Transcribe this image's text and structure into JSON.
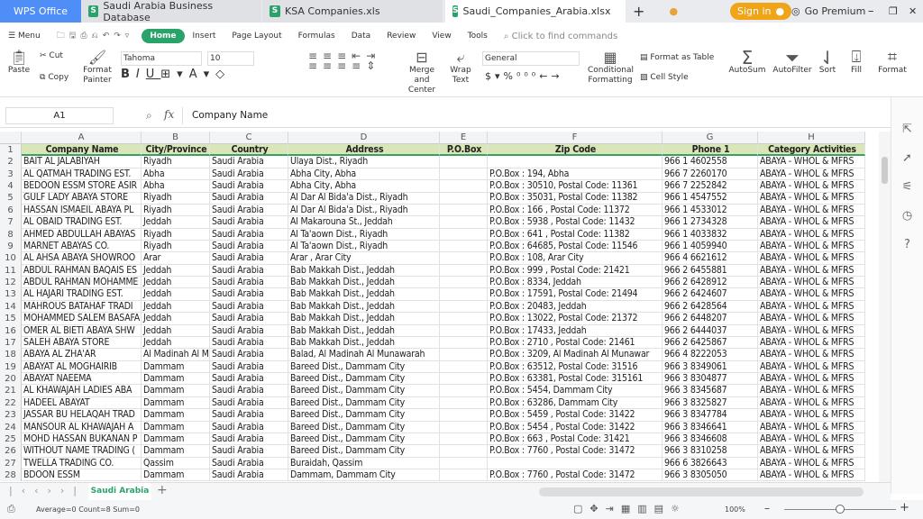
{
  "window": {
    "app_tab": "WPS Office",
    "tabs": [
      "Saudi Arabia Business Database",
      "KSA Companies.xls",
      "Saudi_Companies_Arabia.xlsx"
    ],
    "sign_in": "Sign in",
    "go_premium": "Go Premium"
  },
  "menu": {
    "menu_label": "Menu",
    "tabs": [
      "Home",
      "Insert",
      "Page Layout",
      "Formulas",
      "Data",
      "Review",
      "View",
      "Tools"
    ],
    "search_placeholder": "Click to find commands"
  },
  "ribbon": {
    "paste": "Paste",
    "cut": "Cut",
    "copy": "Copy",
    "format_painter": [
      "Format",
      "Painter"
    ],
    "font": "Tahoma",
    "size": "10",
    "merge": [
      "Merge and",
      "Center"
    ],
    "wrap": [
      "Wrap",
      "Text"
    ],
    "number_format": "General",
    "conditional": [
      "Conditional",
      "Formatting"
    ],
    "format_table": "Format as Table",
    "cell_style": "Cell Style",
    "autosum": "AutoSum",
    "autofilter": "AutoFilter",
    "sort": "Sort",
    "fill": "Fill",
    "format": "Format"
  },
  "formula_bar": {
    "cell_ref": "A1",
    "fx": "fx",
    "value": "Company Name"
  },
  "columns": [
    "A",
    "B",
    "C",
    "D",
    "E",
    "F",
    "G",
    "H"
  ],
  "headers": [
    "Company Name",
    "City/Province",
    "Country",
    "Address",
    "P.O.Box",
    "Zip Code",
    "Phone 1",
    "Category Activities"
  ],
  "rows": [
    [
      "BAIT AL JALABIYAH",
      "Riyadh",
      "Saudi Arabia",
      "Ulaya Dist., Riyadh",
      "",
      "",
      "966 1 4602558",
      "ABAYA - WHOL & MFRS"
    ],
    [
      "AL QATMAH TRADING EST.",
      "Abha",
      "Saudi Arabia",
      "Abha City, Abha",
      "",
      "P.O.Box : 194, Abha",
      "966 7 2260170",
      "ABAYA - WHOL & MFRS"
    ],
    [
      "BEDOON ESSM STORE ASIR",
      "Abha",
      "Saudi Arabia",
      "Abha City, Abha",
      "",
      "P.O.Box : 30510, Postal Code: 11361",
      "966 7 2252842",
      "ABAYA - WHOL & MFRS"
    ],
    [
      "GULF LADY ABAYA STORE",
      "Riyadh",
      "Saudi Arabia",
      "Al Dar Al Bida'a Dist., Riyadh",
      "",
      "P.O.Box : 35031, Postal Code: 11382",
      "966 1 4547552",
      "ABAYA - WHOL & MFRS"
    ],
    [
      "HASSAN ISMAEIL ABAYA PL",
      "Riyadh",
      "Saudi Arabia",
      "Al Dar Al Bida'a Dist., Riyadh",
      "",
      "P.O.Box : 166 , Postal Code: 11372",
      "966 1 4533012",
      "ABAYA - WHOL & MFRS"
    ],
    [
      "AL OBAID TRADING EST.",
      "Jeddah",
      "Saudi Arabia",
      "Al Makarouna St., Jeddah",
      "",
      "P.O.Box : 5938 , Postal Code: 11432",
      "966 1 2734328",
      "ABAYA - WHOL & MFRS"
    ],
    [
      "AHMED ABDULLAH ABAYAS",
      "Riyadh",
      "Saudi Arabia",
      "Al Ta'aown Dist., Riyadh",
      "",
      "P.O.Box : 641 , Postal Code: 11382",
      "966 1 4033832",
      "ABAYA - WHOL & MFRS"
    ],
    [
      "MARNET ABAYAS CO.",
      "Riyadh",
      "Saudi Arabia",
      "Al Ta'aown Dist., Riyadh",
      "",
      "P.O.Box : 64685, Postal Code: 11546",
      "966 1 4059940",
      "ABAYA - WHOL & MFRS"
    ],
    [
      "AL AHSA ABAYA SHOWROO",
      "Arar",
      "Saudi Arabia",
      "Arar , Arar City",
      "",
      "P.O.Box : 108, Arar City",
      "966 4 6621612",
      "ABAYA - WHOL & MFRS"
    ],
    [
      "ABDUL RAHMAN BAQAIS ES",
      "Jeddah",
      "Saudi Arabia",
      "Bab Makkah Dist., Jeddah",
      "",
      "P.O.Box : 999 , Postal Code: 21421",
      "966 2 6455881",
      "ABAYA - WHOL & MFRS"
    ],
    [
      "ABDUL RAHMAN MOHAMME",
      "Jeddah",
      "Saudi Arabia",
      "Bab Makkah Dist., Jeddah",
      "",
      "P.O.Box : 8334, Jeddah",
      "966 2 6428912",
      "ABAYA - WHOL & MFRS"
    ],
    [
      "AL HAJARI TRADING EST.",
      "Jeddah",
      "Saudi Arabia",
      "Bab Makkah Dist., Jeddah",
      "",
      "P.O.Box : 17591, Postal Code: 21494",
      "966 2 6424607",
      "ABAYA - WHOL & MFRS"
    ],
    [
      "MAHROUS BATAHAF TRADI",
      "Jeddah",
      "Saudi Arabia",
      "Bab Makkah Dist., Jeddah",
      "",
      "P.O.Box : 20483, Jeddah",
      "966 2 6428564",
      "ABAYA - WHOL & MFRS"
    ],
    [
      "MOHAMMED SALEM BASAFA",
      "Jeddah",
      "Saudi Arabia",
      "Bab Makkah Dist., Jeddah",
      "",
      "P.O.Box : 13022, Postal Code: 21372",
      "966 2 6448207",
      "ABAYA - WHOL & MFRS"
    ],
    [
      "OMER AL BIETI ABAYA SHW",
      "Jeddah",
      "Saudi Arabia",
      "Bab Makkah Dist., Jeddah",
      "",
      "P.O.Box : 17433, Jeddah",
      "966 2 6444037",
      "ABAYA - WHOL & MFRS"
    ],
    [
      "SALEH ABAYA STORE",
      "Jeddah",
      "Saudi Arabia",
      "Bab Makkah Dist., Jeddah",
      "",
      "P.O.Box : 2710 , Postal Code: 21461",
      "966 2 6425867",
      "ABAYA - WHOL & MFRS"
    ],
    [
      "ABAYA AL ZHA'AR",
      "Al Madinah Al M",
      "Saudi Arabia",
      "Balad, Al Madinah Al Munawarah",
      "",
      "P.O.Box : 3209, Al Madinah Al Munawar",
      "966 4 8222053",
      "ABAYA - WHOL & MFRS"
    ],
    [
      "ABAYAT AL MOGHAIRIB",
      "Dammam",
      "Saudi Arabia",
      "Bareed Dist., Dammam City",
      "",
      "P.O.Box : 63512, Postal Code: 31516",
      "966 3 8349061",
      "ABAYA - WHOL & MFRS"
    ],
    [
      "ABAYAT NAEEMA",
      "Dammam",
      "Saudi Arabia",
      "Bareed Dist., Dammam City",
      "",
      "P.O.Box : 63381, Postal Code: 315161",
      "966 3 8304877",
      "ABAYA - WHOL & MFRS"
    ],
    [
      "AL KHAWAJAH LADIES ABA",
      "Dammam",
      "Saudi Arabia",
      "Bareed Dist., Dammam City",
      "",
      "P.O.Box : 5454, Dammam City",
      "966 3 8345687",
      "ABAYA - WHOL & MFRS"
    ],
    [
      "HADEEL ABAYAT",
      "Dammam",
      "Saudi Arabia",
      "Bareed Dist., Dammam City",
      "",
      "P.O.Box : 63286, Dammam City",
      "966 3 8325827",
      "ABAYA - WHOL & MFRS"
    ],
    [
      "JASSAR BU HELAQAH TRAD",
      "Dammam",
      "Saudi Arabia",
      "Bareed Dist., Dammam City",
      "",
      "P.O.Box : 5459 , Postal Code: 31422",
      "966 3 8347784",
      "ABAYA - WHOL & MFRS"
    ],
    [
      "MANSOUR AL KHAWAJAH A",
      "Dammam",
      "Saudi Arabia",
      "Bareed Dist., Dammam City",
      "",
      "P.O.Box : 5454 , Postal Code: 31422",
      "966 3 8346641",
      "ABAYA - WHOL & MFRS"
    ],
    [
      "MOHD HASSAN BUKANAN P",
      "Dammam",
      "Saudi Arabia",
      "Bareed Dist., Dammam City",
      "",
      "P.O.Box : 663 , Postal Code: 31421",
      "966 3 8346608",
      "ABAYA - WHOL & MFRS"
    ],
    [
      "WITHOUT NAME TRADING (",
      "Dammam",
      "Saudi Arabia",
      "Bareed Dist., Dammam City",
      "",
      "P.O.Box : 7760 , Postal Code: 31472",
      "966 3 8310258",
      "ABAYA - WHOL & MFRS"
    ],
    [
      "TWELLA TRADING CO.",
      "Qassim",
      "Saudi Arabia",
      "Buraidah, Qassim",
      "",
      "",
      "966 6 3826643",
      "ABAYA - WHOL & MFRS"
    ],
    [
      "BDOON ESSM",
      "Dammam",
      "Saudi Arabia",
      "Dammam, Dammam City",
      "",
      "P.O.Box : 7760 , Postal Code: 31472",
      "966 3 8305050",
      "ABAYA - WHOL & MFRS"
    ]
  ],
  "sheet_tab": "Saudi Arabia",
  "status": {
    "summary": "Average=0  Count=8  Sum=0",
    "zoom": "100%",
    "zoom_fraction": 0.5
  },
  "colors": {
    "accent": "#2aa36b",
    "header_fill": "#d9e6b8",
    "wps_tab": "#4f8ef7",
    "sign_in": "#f0a418"
  }
}
